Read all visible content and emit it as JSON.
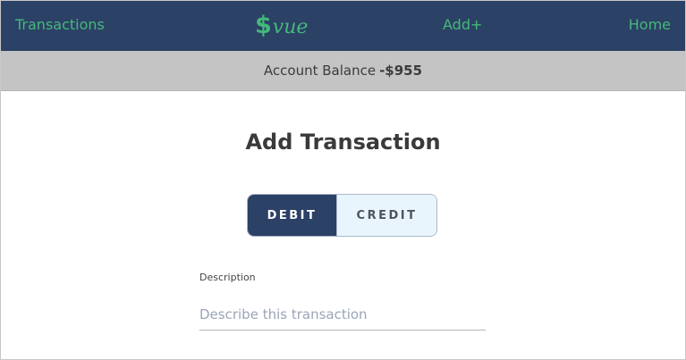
{
  "nav": {
    "transactions": "Transactions",
    "brand_dollar": "$",
    "brand_text": "vue",
    "add": "Add+",
    "home": "Home"
  },
  "balance": {
    "label": "Account Balance",
    "amount": "-$955"
  },
  "form": {
    "title": "Add Transaction",
    "type_toggle": {
      "debit": "DEBIT",
      "credit": "CREDIT",
      "selected": "DEBIT"
    },
    "description": {
      "label": "Description",
      "value": "",
      "placeholder": "Describe this transaction"
    }
  },
  "colors": {
    "nav_background": "#2c4166",
    "nav_link": "#44b97a",
    "balance_background": "#c4c4c4",
    "debit_selected": "#2c4166",
    "credit_unselected": "#e9f5fd"
  }
}
